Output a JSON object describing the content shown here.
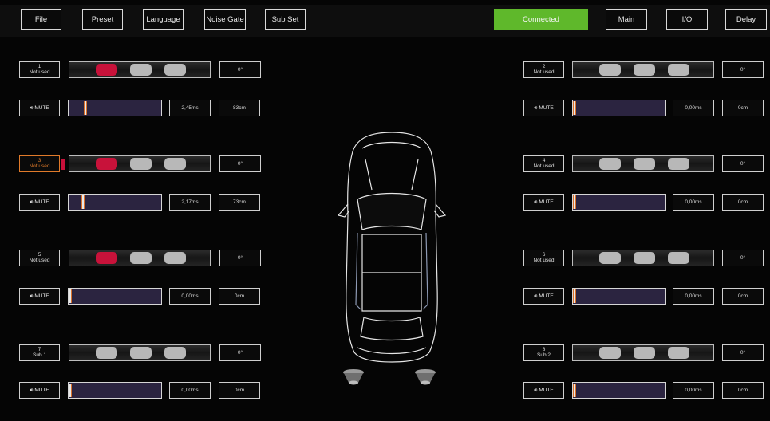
{
  "toolbar": {
    "file": "File",
    "preset": "Preset",
    "language": "Language",
    "noise_gate": "Noise Gate",
    "sub_set": "Sub Set",
    "status": "Connected",
    "main": "Main",
    "io": "I/O",
    "delay": "Delay"
  },
  "mute_label": "MUTE",
  "colors": {
    "accent_green": "#5fb82b",
    "active_red": "#c8123a",
    "slider_fill": "#2b2440",
    "active_orange": "#e07a2a"
  },
  "channels": {
    "ch1": {
      "num": "1",
      "name": "Not used",
      "phase": "0°",
      "delay_ms": "2,45ms",
      "distance": "83cm"
    },
    "ch2": {
      "num": "2",
      "name": "Not used",
      "phase": "0°",
      "delay_ms": "0,00ms",
      "distance": "0cm"
    },
    "ch3": {
      "num": "3",
      "name": "Not used",
      "phase": "0°",
      "delay_ms": "2,17ms",
      "distance": "73cm"
    },
    "ch4": {
      "num": "4",
      "name": "Not used",
      "phase": "0°",
      "delay_ms": "0,00ms",
      "distance": "0cm"
    },
    "ch5": {
      "num": "5",
      "name": "Not used",
      "phase": "0°",
      "delay_ms": "0,00ms",
      "distance": "0cm"
    },
    "ch6": {
      "num": "6",
      "name": "Not used",
      "phase": "0°",
      "delay_ms": "0,00ms",
      "distance": "0cm"
    },
    "ch7": {
      "num": "7",
      "name": "Sub 1",
      "phase": "0°",
      "delay_ms": "0,00ms",
      "distance": "0cm"
    },
    "ch8": {
      "num": "8",
      "name": "Sub 2",
      "phase": "0°",
      "delay_ms": "0,00ms",
      "distance": "0cm"
    }
  }
}
